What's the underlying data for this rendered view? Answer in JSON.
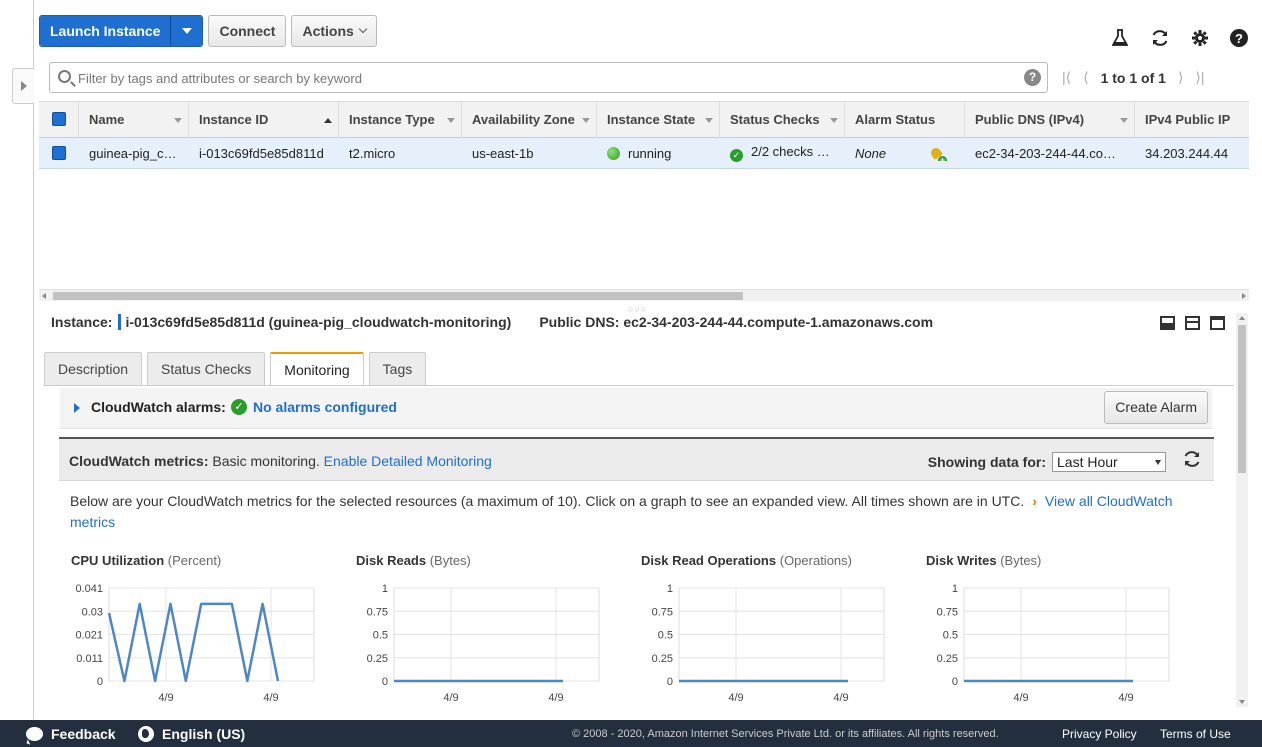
{
  "toolbar": {
    "launch_label": "Launch Instance",
    "connect_label": "Connect",
    "actions_label": "Actions"
  },
  "search": {
    "placeholder": "Filter by tags and attributes or search by keyword"
  },
  "pager": {
    "text": "1 to 1 of 1"
  },
  "table": {
    "columns": [
      "Name",
      "Instance ID",
      "Instance Type",
      "Availability Zone",
      "Instance State",
      "Status Checks",
      "Alarm Status",
      "Public DNS (IPv4)",
      "IPv4 Public IP"
    ],
    "row": {
      "name": "guinea-pig_c…",
      "instance_id": "i-013c69fd5e85d811d",
      "instance_type": "t2.micro",
      "availability_zone": "us-east-1b",
      "instance_state": "running",
      "status_checks": "2/2 checks …",
      "alarm_status": "None",
      "public_dns": "ec2-34-203-244-44.co…",
      "public_ip": "34.203.244.44"
    }
  },
  "details": {
    "instance_label": "Instance:",
    "instance_value": "i-013c69fd5e85d811d (guinea-pig_cloudwatch-monitoring)",
    "dns_label": "Public DNS:",
    "dns_value": "ec2-34-203-244-44.compute-1.amazonaws.com"
  },
  "tabs": [
    "Description",
    "Status Checks",
    "Monitoring",
    "Tags"
  ],
  "alarms": {
    "label": "CloudWatch alarms:",
    "value": "No alarms configured",
    "create_label": "Create Alarm"
  },
  "metrics": {
    "label": "CloudWatch metrics:",
    "monitoring": "Basic monitoring.",
    "enable_link": "Enable Detailed Monitoring",
    "showing_label": "Showing data for:",
    "period": "Last Hour",
    "description": "Below are your CloudWatch metrics for the selected resources (a maximum of 10). Click on a graph to see an expanded view. All times shown are in UTC.",
    "arrow": "›",
    "view_all": "View all CloudWatch metrics"
  },
  "chart_data": [
    {
      "type": "line",
      "title": "CPU Utilization",
      "unit": "(Percent)",
      "yticks": [
        "0.041",
        "0.03",
        "0.021",
        "0.011",
        "0"
      ],
      "ylim": [
        0,
        0.041
      ],
      "xticks": [
        "4/9",
        "4/9"
      ],
      "values": [
        0.03,
        0,
        0.034,
        0,
        0.034,
        0,
        0.034,
        0.034,
        0.034,
        0,
        0.034,
        0
      ],
      "color": "#4f86c6"
    },
    {
      "type": "line",
      "title": "Disk Reads",
      "unit": "(Bytes)",
      "yticks": [
        "1",
        "0.75",
        "0.5",
        "0.25",
        "0"
      ],
      "ylim": [
        0,
        1
      ],
      "xticks": [
        "4/9",
        "4/9"
      ],
      "values": [
        0,
        0,
        0,
        0,
        0,
        0,
        0,
        0,
        0,
        0,
        0,
        0
      ],
      "color": "#4f86c6"
    },
    {
      "type": "line",
      "title": "Disk Read Operations",
      "unit": "(Operations)",
      "yticks": [
        "1",
        "0.75",
        "0.5",
        "0.25",
        "0"
      ],
      "ylim": [
        0,
        1
      ],
      "xticks": [
        "4/9",
        "4/9"
      ],
      "values": [
        0,
        0,
        0,
        0,
        0,
        0,
        0,
        0,
        0,
        0,
        0,
        0
      ],
      "color": "#4f86c6"
    },
    {
      "type": "line",
      "title": "Disk Writes",
      "unit": "(Bytes)",
      "yticks": [
        "1",
        "0.75",
        "0.5",
        "0.25",
        "0"
      ],
      "ylim": [
        0,
        1
      ],
      "xticks": [
        "4/9",
        "4/9"
      ],
      "values": [
        0,
        0,
        0,
        0,
        0,
        0,
        0,
        0,
        0,
        0,
        0,
        0
      ],
      "color": "#4f86c6"
    }
  ],
  "footer": {
    "feedback": "Feedback",
    "language": "English (US)",
    "copyright": "© 2008 - 2020, Amazon Internet Services Private Ltd. or its affiliates. All rights reserved.",
    "privacy": "Privacy Policy",
    "terms": "Terms of Use"
  }
}
